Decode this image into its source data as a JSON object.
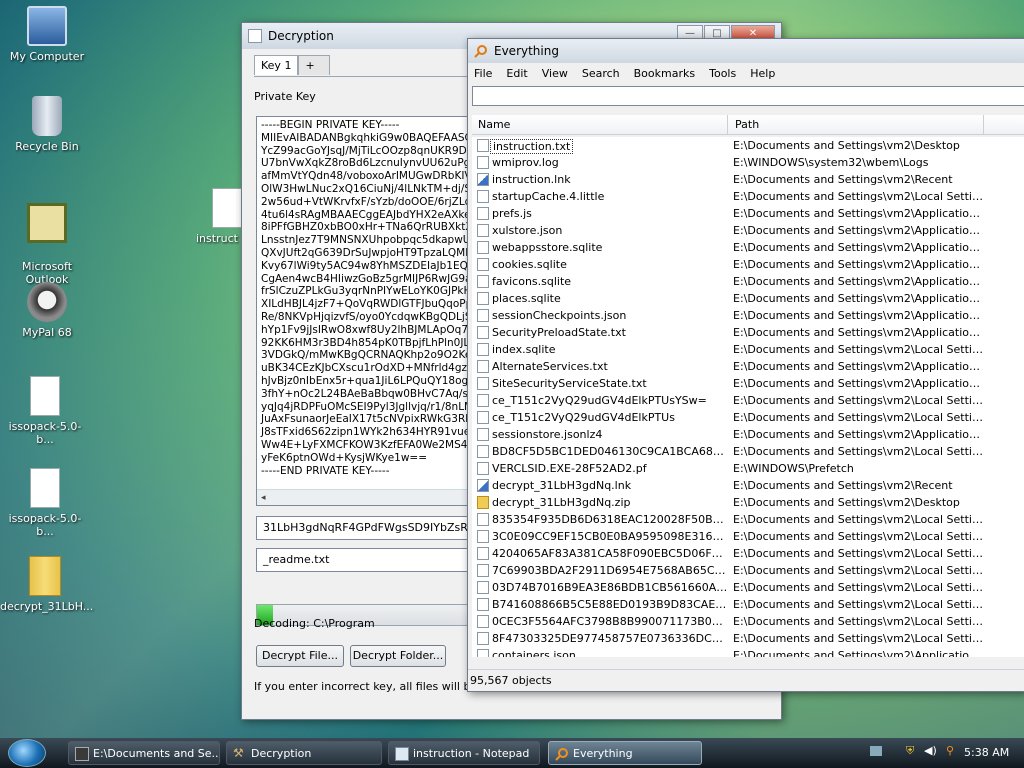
{
  "desktop": {
    "icons": [
      {
        "label": "My Computer"
      },
      {
        "label": "Recycle Bin"
      },
      {
        "label": "Microsoft\nOutlook"
      },
      {
        "label": "MyPal 68"
      },
      {
        "label": "issopack-5.0-b..."
      },
      {
        "label": "issopack-5.0-b..."
      },
      {
        "label": "decrypt_31LbH..."
      },
      {
        "label": "instruct"
      }
    ]
  },
  "decryption": {
    "title": "Decryption",
    "tabs": [
      "Key 1",
      "+"
    ],
    "private_key_label": "Private Key",
    "key_lines": [
      "-----BEGIN PRIVATE KEY-----",
      "MIIEvAIBADANBgkqhkiG9w0BAQEFAASCBK",
      "YcZ99acGoYJsqJ/MjTiLcOOzp8qnUKR9Dbk",
      "U7bnVwXqkZ8roBd6LzcnuIynvUU62uPg9jY",
      "afMmVtYQdn48/voboxoArIMUGwDRbKIVEk",
      "OlW3HwLNuc2xQ16CiuNj/4lLNkTM+dj/S9xU",
      "2w56ud+VtWKrvfxF/sYzb/doOOE/6rjZLdU8",
      "4tu6l4sRAgMBAAECggEAJbdYHX2eAXkeDf",
      "8iPFfGBHZ0xbBO0xHr+TNa6QrRUBXktXOo",
      "LnsstnJez7T9MNSNXUhpobpqc5dkapwUbV",
      "QXvJUft2qG639DrSuJwpjoHT9TpzaLQMBK",
      "Kvy67lWi9ty5AC94w8YhMSZDEIaJb1EQjMF",
      "CgAen4wcB4HIiwzGoBz5grMIJP6RwJG9aZ/",
      "frSlCzuZPLkGu3yqrNnPIYwELoYK0GJPkH5Q",
      "XILdHBJL4jzF7+QoVqRWDlGTFJbuQqoPpLr",
      "Re/8NKVpHjqizvfS/oyo0YcdqwKBgQDLjS2d",
      "hYp1Fv9jJsIRwO8xwf8Uy2lhBJMLApOq7Ve",
      "92KK6HM3r3BD4h854pK0TBpjfLhPln0JLR0D",
      "3VDGkQ/mMwKBgQCRNAQKhp2o9O2Ke/GE",
      "uBK34CEzKJbCXscu1rOdXD+MNfrld4gz/uFa",
      "hJvBjz0nIbEnx5r+qua1JiL6LPQuQY18ogpq",
      "3fhY+nOc2L24BAeBaBbqw0BHvC7Aq/soKD",
      "yqJq4jRDPFuOMcSEI9Pyl3Jgllvjq/r1/8nLM",
      "JuAxFsunaorJeEaIX17t5cNVpixRWkG3Rbta",
      "J8sTFxid6S62zipn1WYk2h634HYR91vuegv",
      "Ww4E+LyFXMCFKOW3KzfEFA0We2MS4lq",
      "yFeK6ptnOWd+KysjWKye1w==",
      "-----END PRIVATE KEY-----"
    ],
    "scroll_left": "◂",
    "key_id_value": "31LbH3gdNqRF4GPdFWgsSD9IYbZsR93B5N",
    "readme_value": "_readme.txt",
    "progress": 0.07,
    "decoding_text": "Decoding: C:\\Program",
    "decrypt_file_label": "Decrypt File...",
    "decrypt_folder_label": "Decrypt Folder...",
    "warning_text": "If you enter incorrect key, all files will be per"
  },
  "everything": {
    "title": "Everything",
    "menu": [
      "File",
      "Edit",
      "View",
      "Search",
      "Bookmarks",
      "Tools",
      "Help"
    ],
    "search_value": "",
    "columns": {
      "name": "Name",
      "path": "Path"
    },
    "rows": [
      {
        "name": "instruction.txt",
        "path": "E:\\Documents and Settings\\vm2\\Desktop",
        "icon": "txt",
        "selected": true
      },
      {
        "name": "wmiprov.log",
        "path": "E:\\WINDOWS\\system32\\wbem\\Logs",
        "icon": "txt"
      },
      {
        "name": "instruction.lnk",
        "path": "E:\\Documents and Settings\\vm2\\Recent",
        "icon": "lnk"
      },
      {
        "name": "startupCache.4.little",
        "path": "E:\\Documents and Settings\\vm2\\Local Settings...",
        "icon": "txt"
      },
      {
        "name": "prefs.js",
        "path": "E:\\Documents and Settings\\vm2\\Application D...",
        "icon": "txt"
      },
      {
        "name": "xulstore.json",
        "path": "E:\\Documents and Settings\\vm2\\Application D...",
        "icon": "txt"
      },
      {
        "name": "webappsstore.sqlite",
        "path": "E:\\Documents and Settings\\vm2\\Application D...",
        "icon": "txt"
      },
      {
        "name": "cookies.sqlite",
        "path": "E:\\Documents and Settings\\vm2\\Application D...",
        "icon": "txt"
      },
      {
        "name": "favicons.sqlite",
        "path": "E:\\Documents and Settings\\vm2\\Application D...",
        "icon": "txt"
      },
      {
        "name": "places.sqlite",
        "path": "E:\\Documents and Settings\\vm2\\Application D...",
        "icon": "txt"
      },
      {
        "name": "sessionCheckpoints.json",
        "path": "E:\\Documents and Settings\\vm2\\Application D...",
        "icon": "txt"
      },
      {
        "name": "SecurityPreloadState.txt",
        "path": "E:\\Documents and Settings\\vm2\\Application D...",
        "icon": "txt"
      },
      {
        "name": "index.sqlite",
        "path": "E:\\Documents and Settings\\vm2\\Local Settings...",
        "icon": "txt"
      },
      {
        "name": "AlternateServices.txt",
        "path": "E:\\Documents and Settings\\vm2\\Application D...",
        "icon": "txt"
      },
      {
        "name": "SiteSecurityServiceState.txt",
        "path": "E:\\Documents and Settings\\vm2\\Application D...",
        "icon": "txt"
      },
      {
        "name": "ce_T151c2VyQ29udGV4dElkPTUsYSw=",
        "path": "E:\\Documents and Settings\\vm2\\Local Settings...",
        "icon": "txt"
      },
      {
        "name": "ce_T151c2VyQ29udGV4dElkPTUs",
        "path": "E:\\Documents and Settings\\vm2\\Local Settings...",
        "icon": "txt"
      },
      {
        "name": "sessionstore.jsonlz4",
        "path": "E:\\Documents and Settings\\vm2\\Application D...",
        "icon": "txt"
      },
      {
        "name": "BD8CF5D5BC1DED046130C9CA1BCA68C154...",
        "path": "E:\\Documents and Settings\\vm2\\Local Settings...",
        "icon": "txt"
      },
      {
        "name": "VERCLSID.EXE-28F52AD2.pf",
        "path": "E:\\WINDOWS\\Prefetch",
        "icon": "txt"
      },
      {
        "name": "decrypt_31LbH3gdNq.lnk",
        "path": "E:\\Documents and Settings\\vm2\\Recent",
        "icon": "lnk"
      },
      {
        "name": "decrypt_31LbH3gdNq.zip",
        "path": "E:\\Documents and Settings\\vm2\\Desktop",
        "icon": "zip"
      },
      {
        "name": "835354F935DB6D6318EAC120028F50B5AB2...",
        "path": "E:\\Documents and Settings\\vm2\\Local Settings...",
        "icon": "txt"
      },
      {
        "name": "3C0E09CC9EF15CB0E0BA9595098E3167914...",
        "path": "E:\\Documents and Settings\\vm2\\Local Settings...",
        "icon": "txt"
      },
      {
        "name": "4204065AF83A381CA58F090EBC5D06F77AA...",
        "path": "E:\\Documents and Settings\\vm2\\Local Settings...",
        "icon": "txt"
      },
      {
        "name": "7C69903BDA2F2911D6954E7568AB65C0CA8...",
        "path": "E:\\Documents and Settings\\vm2\\Local Settings...",
        "icon": "txt"
      },
      {
        "name": "03D74B7016B9EA3E86BDB1CB561660A23FB...",
        "path": "E:\\Documents and Settings\\vm2\\Local Settings...",
        "icon": "txt"
      },
      {
        "name": "B741608866B5C5E88ED0193B9D83CAEBA09...",
        "path": "E:\\Documents and Settings\\vm2\\Local Settings...",
        "icon": "txt"
      },
      {
        "name": "0CEC3F5564AFC3798B8B990071173B032541...",
        "path": "E:\\Documents and Settings\\vm2\\Local Settings...",
        "icon": "txt"
      },
      {
        "name": "8F47303325DE977458757E0736336DC9064E...",
        "path": "E:\\Documents and Settings\\vm2\\Local Settings...",
        "icon": "txt"
      },
      {
        "name": "containers.json",
        "path": "E:\\Documents and Settings\\vm2\\Application D...",
        "icon": "txt"
      }
    ],
    "status": "95,567 objects"
  },
  "taskbar": {
    "tasks": [
      {
        "label": "E:\\Documents and Se...",
        "active": false
      },
      {
        "label": "Decryption",
        "active": false
      },
      {
        "label": "instruction - Notepad",
        "active": false
      },
      {
        "label": "Everything",
        "active": true
      }
    ],
    "clock": "5:38 AM"
  },
  "colors": {
    "progress_fill": "#1fa01f",
    "active_task": "#34495a"
  }
}
